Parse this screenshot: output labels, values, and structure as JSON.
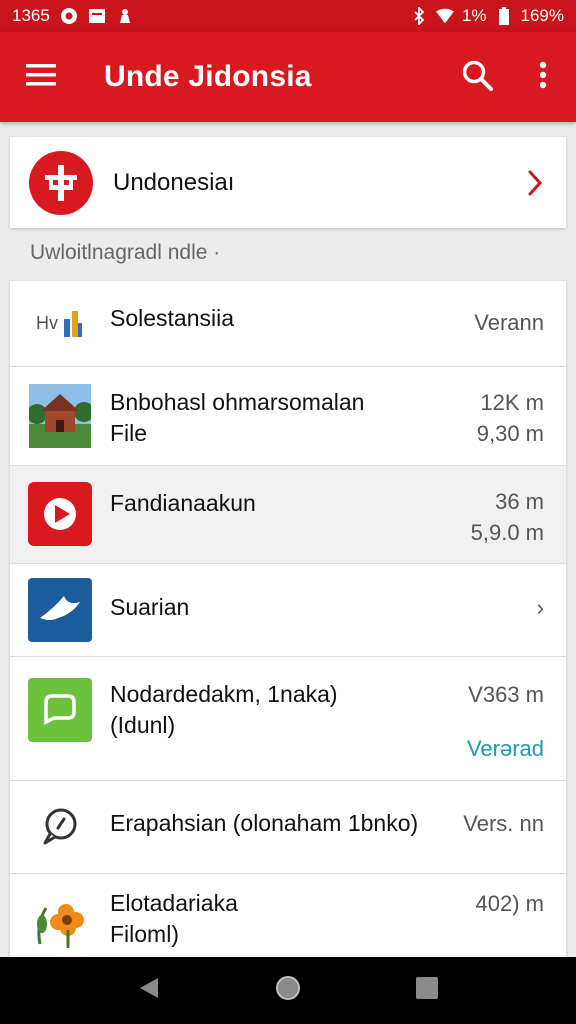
{
  "status_bar": {
    "time": "1365",
    "battery_text": "1%",
    "signal_text": "169%"
  },
  "app_bar": {
    "title": "Unde Jidonsia",
    "menu_icon": "menu-icon",
    "search_icon": "search-icon",
    "overflow_icon": "more-vert-icon"
  },
  "hero": {
    "name": "Undonesiaı",
    "icon": "emblem-icon"
  },
  "section": {
    "label": "Uwloitlnagradl ndle ·"
  },
  "list": [
    {
      "icon": "document-icon",
      "icon_prefix": "Hv",
      "title": "Solestansiia",
      "subtitle": "",
      "meta1": "Verann",
      "meta2": ""
    },
    {
      "icon": "building-photo",
      "title": "Bnbohasl ohmarsomalan",
      "subtitle": "File",
      "meta1": "12K m",
      "meta2": "9,30 m"
    },
    {
      "icon": "play-icon",
      "title": "Fandianaakun",
      "subtitle": "",
      "meta1": "36 m",
      "meta2": "5,9.0 m"
    },
    {
      "icon": "bird-icon",
      "title": "Suarian",
      "subtitle": "",
      "meta1": "›",
      "meta2": ""
    },
    {
      "icon": "chat-bubble-icon",
      "title": "Nodardedakm, 1naka)",
      "subtitle": "(Idunl)",
      "meta1": "V363 m",
      "meta2": "Verərad"
    },
    {
      "icon": "comment-outline-icon",
      "title": "Erapahsian (olonaham 1bnko)",
      "subtitle": "",
      "meta1": "Vers. nn",
      "meta2": ""
    },
    {
      "icon": "flower-icon",
      "title": "Elotadariaka",
      "subtitle": "Filoml)",
      "meta1": "402) m",
      "meta2": ""
    }
  ],
  "nav": {
    "back": "back-icon",
    "home": "home-icon",
    "recents": "recents-icon"
  },
  "colors": {
    "brand_red": "#d8191f",
    "accent_teal": "#1a9cb0"
  }
}
